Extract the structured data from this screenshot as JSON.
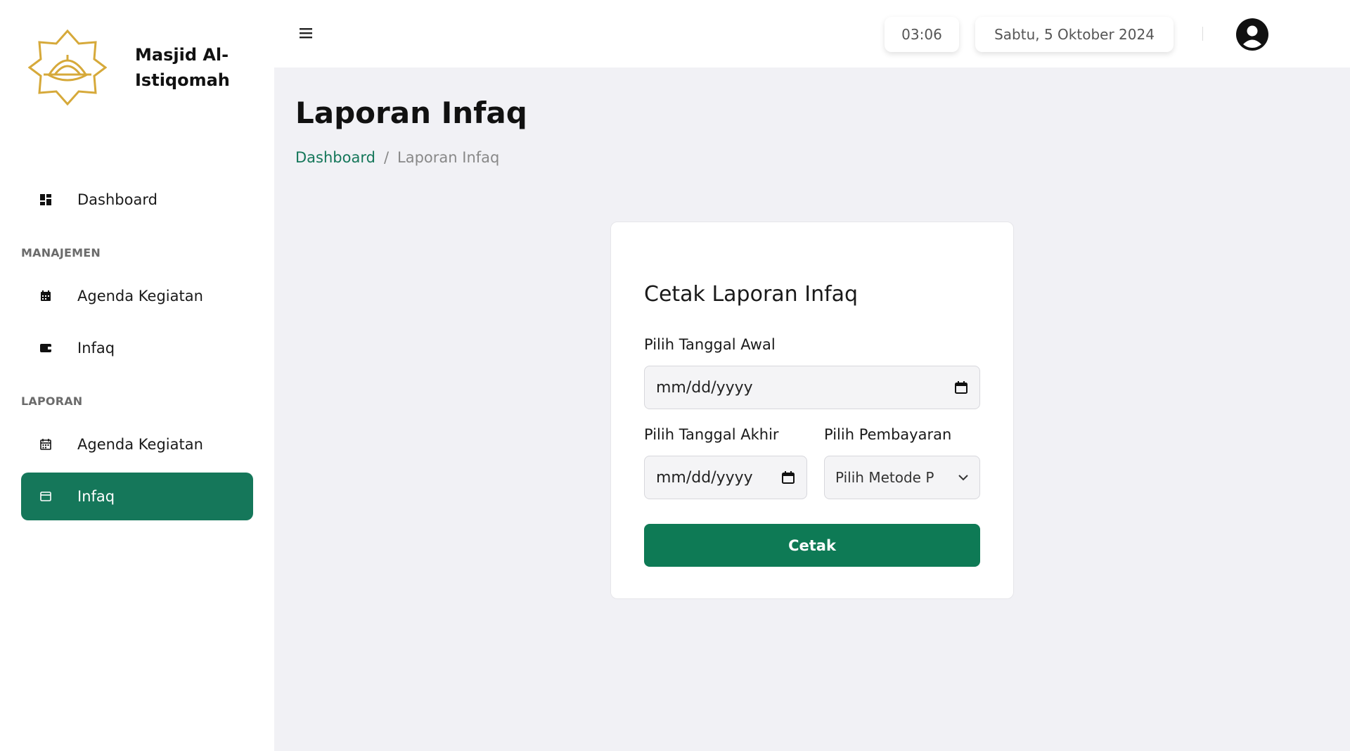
{
  "brand": {
    "name": "Masjid Al-Istiqomah",
    "logo_icon": "mosque-star-logo",
    "accent": "#d6a93a"
  },
  "sidebar": {
    "items": [
      {
        "label": "Dashboard",
        "icon": "dashboard-icon"
      }
    ],
    "sections": [
      {
        "title": "MANAJEMEN",
        "items": [
          {
            "label": "Agenda Kegiatan",
            "icon": "calendar-icon"
          },
          {
            "label": "Infaq",
            "icon": "wallet-icon"
          }
        ]
      },
      {
        "title": "LAPORAN",
        "items": [
          {
            "label": "Agenda Kegiatan",
            "icon": "calendar-outline-icon"
          },
          {
            "label": "Infaq",
            "icon": "wallet-outline-icon",
            "active": true
          }
        ]
      }
    ]
  },
  "topbar": {
    "menu_icon": "hamburger-icon",
    "time": "03:06",
    "date": "Sabtu, 5 Oktober 2024",
    "avatar_icon": "user-circle-icon"
  },
  "page": {
    "title": "Laporan Infaq",
    "breadcrumb": {
      "link": "Dashboard",
      "separator": "/",
      "current": "Laporan Infaq"
    }
  },
  "form": {
    "title": "Cetak Laporan Infaq",
    "start_date": {
      "label": "Pilih Tanggal Awal",
      "placeholder": "mm/dd/yyyy"
    },
    "end_date": {
      "label": "Pilih Tanggal Akhir",
      "placeholder": "mm/dd/yyyy"
    },
    "payment": {
      "label": "Pilih Pembayaran",
      "selected": "Pilih Metode P"
    },
    "submit_label": "Cetak"
  },
  "colors": {
    "primary": "#15775a",
    "button": "#0e7a55",
    "background": "#f1f1f5"
  }
}
